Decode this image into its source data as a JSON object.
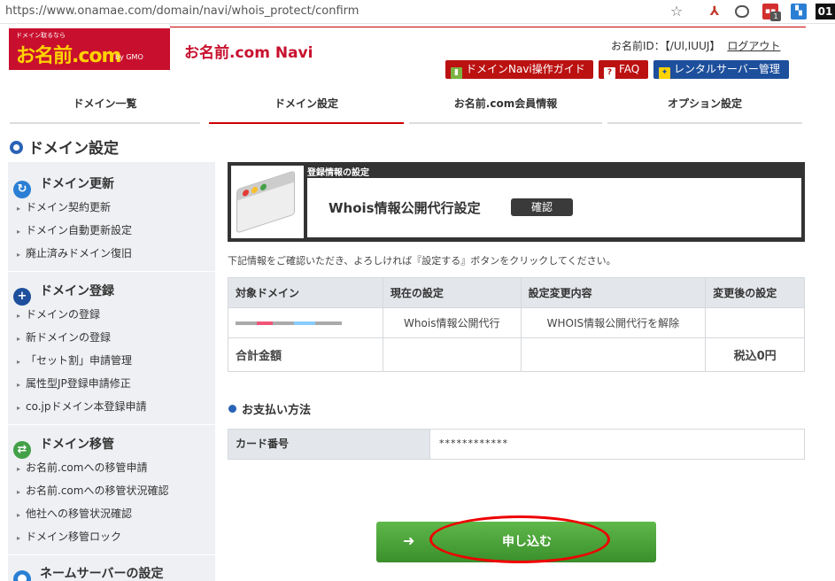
{
  "browser": {
    "url": "https://www.onamae.com/domain/navi/whois_protect/confirm",
    "ext_badge": "1",
    "ext_dark": "01"
  },
  "header": {
    "logo_small": "ドメイン取るなら",
    "logo_main": "お名前.com",
    "logo_sub": "by GMO",
    "site_title": "お名前.com Navi",
    "user_id_label": "お名前ID：",
    "user_id_value": "【/Ul,IUUJ】",
    "logout": "ログアウト",
    "buttons": {
      "guide": "ドメインNavi操作ガイド",
      "faq": "FAQ",
      "server": "レンタルサーバー管理"
    }
  },
  "nav": {
    "tabs": [
      "ドメイン一覧",
      "ドメイン設定",
      "お名前.com会員情報",
      "オプション設定"
    ],
    "active": "ドメイン設定"
  },
  "page_title": "ドメイン設定",
  "sidebar": {
    "sections": [
      {
        "title": "ドメイン更新",
        "items": [
          "ドメイン契約更新",
          "ドメイン自動更新設定",
          "廃止済みドメイン復旧"
        ]
      },
      {
        "title": "ドメイン登録",
        "items": [
          "ドメインの登録",
          "新ドメインの登録",
          "「セット割」申請管理",
          "属性型JP登録申請修正",
          "co.jpドメイン本登録申請"
        ]
      },
      {
        "title": "ドメイン移管",
        "items": [
          "お名前.comへの移管申請",
          "お名前.comへの移管状況確認",
          "他社への移管状況確認",
          "ドメイン移管ロック"
        ]
      },
      {
        "title": "ネームサーバーの設定",
        "items": []
      }
    ]
  },
  "main": {
    "card_label": "登録情報の設定",
    "card_title": "Whois情報公開代行設定",
    "badge": "確認",
    "note": "下記情報をご確認いただき、よろしければ『設定する』ボタンをクリックしてください。",
    "table": {
      "headers": [
        "対象ドメイン",
        "現在の設定",
        "設定変更内容",
        "変更後の設定"
      ],
      "row": [
        "",
        "Whois情報公開代行",
        "WHOIS情報公開代行を解除",
        ""
      ],
      "total_label": "合計金額",
      "total_value": "税込0円"
    },
    "payment": {
      "title": "お支払い方法",
      "card_label": "カード番号",
      "card_value": "************"
    },
    "apply_button": "申し込む"
  }
}
